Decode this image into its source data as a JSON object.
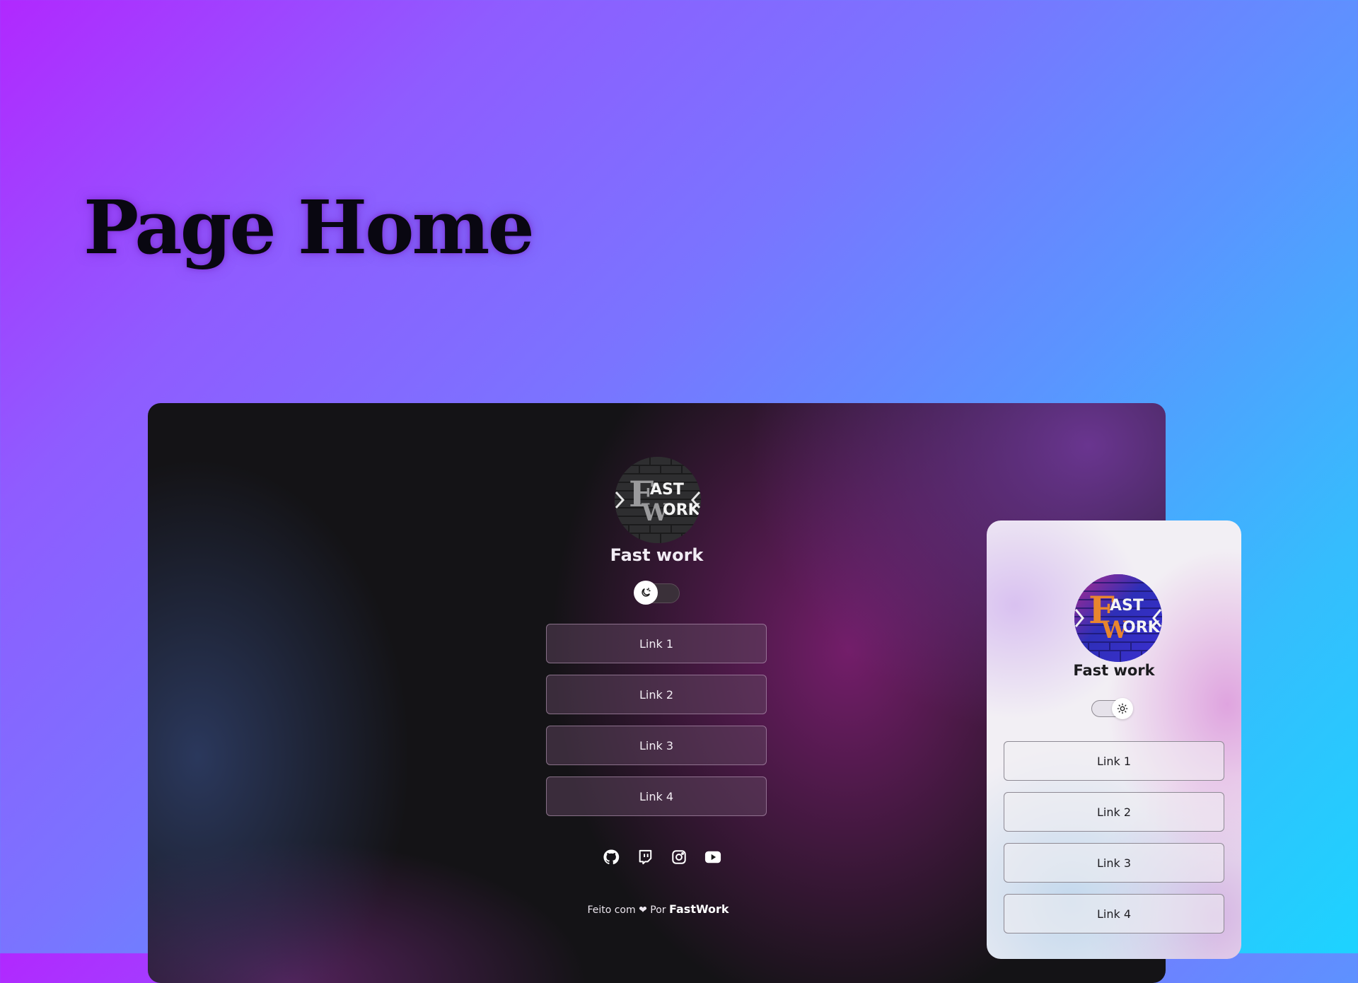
{
  "hero": {
    "title": "Page Home"
  },
  "profile": {
    "logo": {
      "line1": "AST",
      "line2": "ORK",
      "big_f": "F",
      "big_w": "W"
    },
    "name": "Fast work",
    "links": [
      "Link 1",
      "Link 2",
      "Link 3",
      "Link 4"
    ],
    "socials": [
      "github-icon",
      "twitch-icon",
      "instagram-icon",
      "youtube-icon"
    ],
    "footer": {
      "prefix": "Feito com",
      "heart": "❤",
      "by": "Por",
      "brand": "FastWork"
    }
  },
  "dark_preview": {
    "theme": "dark",
    "toggle_icon": "moon-icon"
  },
  "light_preview": {
    "theme": "light",
    "toggle_icon": "sun-icon"
  },
  "colors": {
    "bg_start": "#b128ff",
    "bg_end": "#1dd3ff",
    "dark_base": "#141316",
    "light_base": "#f2eff4"
  }
}
